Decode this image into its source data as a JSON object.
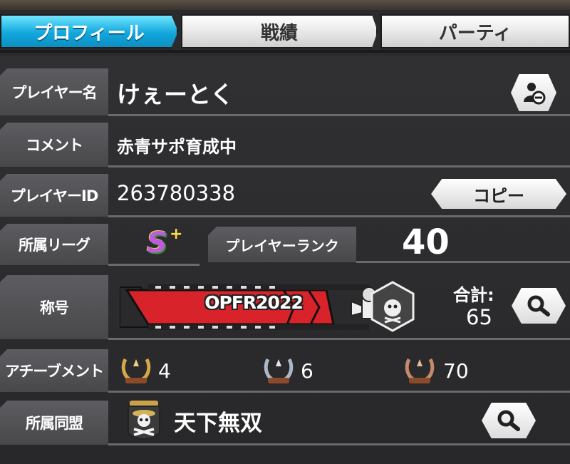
{
  "tabs": [
    {
      "label": "プロフィール",
      "active": true
    },
    {
      "label": "戦績",
      "active": false
    },
    {
      "label": "パーティ",
      "active": false
    }
  ],
  "profile": {
    "name_label": "プレイヤー名",
    "name": "けぇーとく",
    "comment_label": "コメント",
    "comment": "赤青サポ育成中",
    "id_label": "プレイヤーID",
    "id": "263780338",
    "copy_label": "コピー",
    "league_label": "所属リーグ",
    "league_badge": "S",
    "league_plus": "+",
    "rank_label": "プレイヤーランク",
    "rank": "40",
    "title_label": "称号",
    "title_name": "OPFR2022",
    "total_label": "合計:",
    "total_value": "65",
    "achievement_label": "アチーブメント",
    "achievements": {
      "gold": "4",
      "silver": "6",
      "bronze": "70"
    },
    "alliance_label": "所属同盟",
    "alliance_name": "天下無双"
  },
  "icons": [
    "profile-block-icon",
    "search-icon",
    "laurel-gold-icon",
    "laurel-silver-icon",
    "laurel-bronze-icon",
    "pirate-flag-icon",
    "film-reel-icon"
  ],
  "colors": {
    "accent": "#12a7dc",
    "banner_red": "#d9232a",
    "gold": "#d4a84a",
    "silver": "#aab8c8",
    "bronze": "#c48a6a"
  }
}
